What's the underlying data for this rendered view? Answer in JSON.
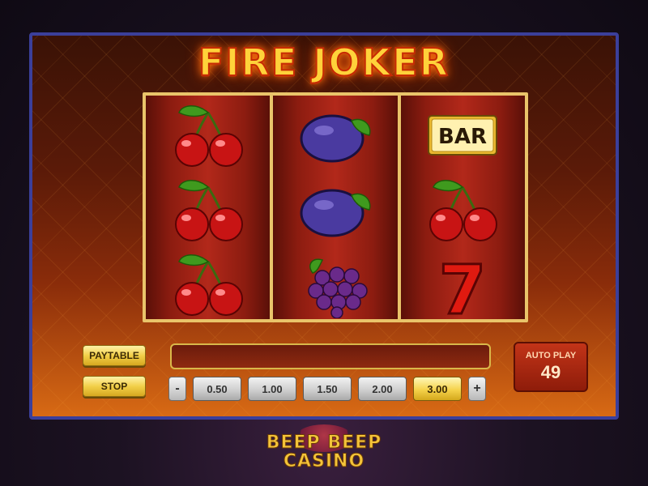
{
  "game": {
    "title": "FIRE JOKER"
  },
  "reels": [
    {
      "symbols": [
        "cherries-icon",
        "cherries-icon",
        "cherries-icon"
      ]
    },
    {
      "symbols": [
        "plum-icon",
        "plum-icon",
        "grapes-icon"
      ]
    },
    {
      "symbols": [
        "bar-icon",
        "cherries-icon",
        "seven-icon"
      ]
    }
  ],
  "bar_label": "BAR",
  "seven_label": "7",
  "controls": {
    "paytable_label": "PAYTABLE",
    "stop_label": "STOP",
    "decrease_label": "-",
    "increase_label": "+",
    "bets": [
      "0.50",
      "1.00",
      "1.50",
      "2.00",
      "3.00"
    ],
    "selected_bet": "3.00",
    "autoplay_label": "AUTO PLAY",
    "autoplay_count": "49"
  },
  "brand": {
    "line1": "BEEP BEEP",
    "line2": "CASINO"
  },
  "colors": {
    "frame_border": "#3b3f9a",
    "gold": "#e9c46a",
    "title_fill": "#ffd23a"
  }
}
